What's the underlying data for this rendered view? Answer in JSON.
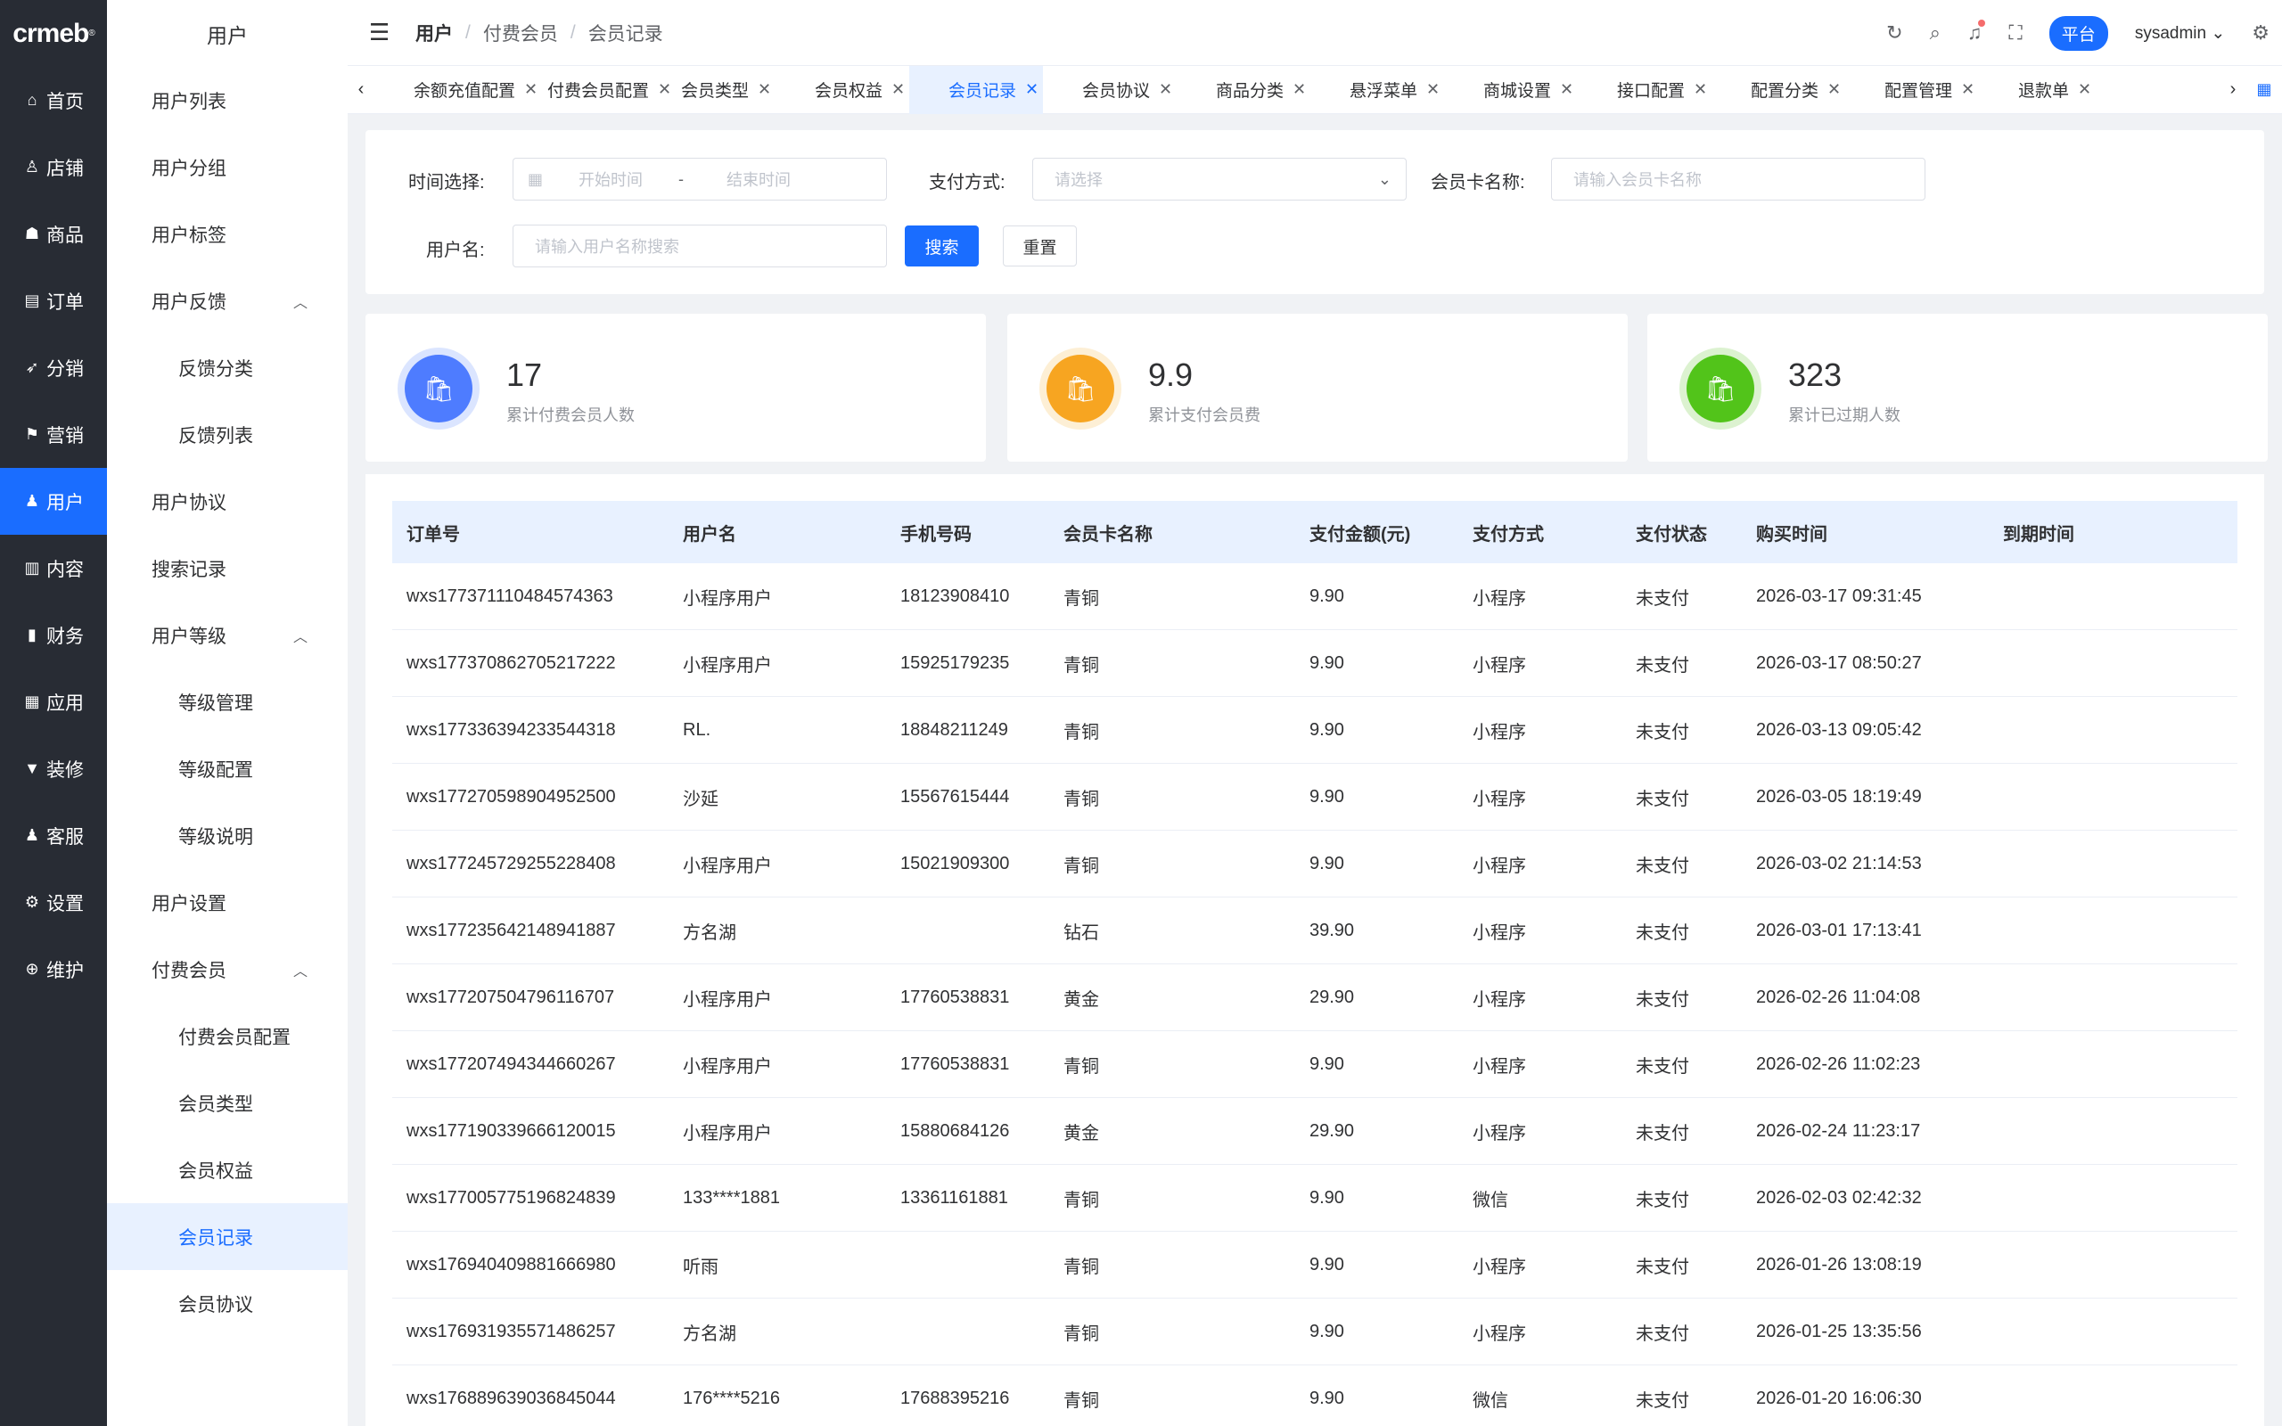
{
  "brand": {
    "logo_text": "crmeb",
    "logo_mark": "®"
  },
  "rail": [
    {
      "label": "首页",
      "icon": "home-icon",
      "glyph": "⌂"
    },
    {
      "label": "店铺",
      "icon": "store-icon",
      "glyph": "♙"
    },
    {
      "label": "商品",
      "icon": "goods-icon",
      "glyph": "☗"
    },
    {
      "label": "订单",
      "icon": "order-icon",
      "glyph": "▤"
    },
    {
      "label": "分销",
      "icon": "distribution-icon",
      "glyph": "➶"
    },
    {
      "label": "营销",
      "icon": "marketing-icon",
      "glyph": "⚑"
    },
    {
      "label": "用户",
      "icon": "user-icon",
      "glyph": "♟",
      "active": true
    },
    {
      "label": "内容",
      "icon": "content-icon",
      "glyph": "▥"
    },
    {
      "label": "财务",
      "icon": "finance-icon",
      "glyph": "▮"
    },
    {
      "label": "应用",
      "icon": "apps-icon",
      "glyph": "▦"
    },
    {
      "label": "装修",
      "icon": "decorate-icon",
      "glyph": "▼"
    },
    {
      "label": "客服",
      "icon": "service-icon",
      "glyph": "♟"
    },
    {
      "label": "设置",
      "icon": "settings-icon",
      "glyph": "⚙"
    },
    {
      "label": "维护",
      "icon": "maintain-icon",
      "glyph": "⊕"
    }
  ],
  "submenu": {
    "title": "用户",
    "items": [
      {
        "label": "用户列表",
        "level": 1
      },
      {
        "label": "用户分组",
        "level": 1
      },
      {
        "label": "用户标签",
        "level": 1
      },
      {
        "label": "用户反馈",
        "level": 1,
        "expanded": true
      },
      {
        "label": "反馈分类",
        "level": 2
      },
      {
        "label": "反馈列表",
        "level": 2
      },
      {
        "label": "用户协议",
        "level": 1
      },
      {
        "label": "搜索记录",
        "level": 1
      },
      {
        "label": "用户等级",
        "level": 1,
        "expanded": true
      },
      {
        "label": "等级管理",
        "level": 2
      },
      {
        "label": "等级配置",
        "level": 2
      },
      {
        "label": "等级说明",
        "level": 2
      },
      {
        "label": "用户设置",
        "level": 1
      },
      {
        "label": "付费会员",
        "level": 1,
        "expanded": true
      },
      {
        "label": "付费会员配置",
        "level": 2
      },
      {
        "label": "会员类型",
        "level": 2
      },
      {
        "label": "会员权益",
        "level": 2
      },
      {
        "label": "会员记录",
        "level": 2,
        "active": true
      },
      {
        "label": "会员协议",
        "level": 2
      }
    ]
  },
  "header": {
    "breadcrumb": [
      "用户",
      "付费会员",
      "会员记录"
    ],
    "platform_label": "平台",
    "username": "sysadmin"
  },
  "tabs": [
    {
      "label": "余额充值配置"
    },
    {
      "label": "付费会员配置"
    },
    {
      "label": "会员类型"
    },
    {
      "label": "会员权益"
    },
    {
      "label": "会员记录",
      "active": true
    },
    {
      "label": "会员协议"
    },
    {
      "label": "商品分类"
    },
    {
      "label": "悬浮菜单"
    },
    {
      "label": "商城设置"
    },
    {
      "label": "接口配置"
    },
    {
      "label": "配置分类"
    },
    {
      "label": "配置管理"
    },
    {
      "label": "退款单"
    }
  ],
  "filter": {
    "time_label": "时间选择:",
    "start_placeholder": "开始时间",
    "range_sep": "-",
    "end_placeholder": "结束时间",
    "pay_label": "支付方式:",
    "pay_placeholder": "请选择",
    "card_label": "会员卡名称:",
    "card_placeholder": "请输入会员卡名称",
    "user_label": "用户名:",
    "user_placeholder": "请输入用户名称搜索",
    "search_btn": "搜索",
    "reset_btn": "重置"
  },
  "stats": [
    {
      "value": "17",
      "label": "累计付费会员人数",
      "color": "#4e7cff",
      "ring": "#dbe5ff"
    },
    {
      "value": "9.9",
      "label": "累计支付会员费",
      "color": "#f7a521",
      "ring": "#fdefd5"
    },
    {
      "value": "323",
      "label": "累计已过期人数",
      "color": "#52c41a",
      "ring": "#dcf2d0"
    }
  ],
  "table": {
    "headers": [
      "订单号",
      "用户名",
      "手机号码",
      "会员卡名称",
      "支付金额(元)",
      "支付方式",
      "支付状态",
      "购买时间",
      "到期时间"
    ],
    "rows": [
      [
        "wxs177371110484574363",
        "小程序用户",
        "18123908410",
        "青铜",
        "9.90",
        "小程序",
        "未支付",
        "2026-03-17 09:31:45",
        ""
      ],
      [
        "wxs177370862705217222",
        "小程序用户",
        "15925179235",
        "青铜",
        "9.90",
        "小程序",
        "未支付",
        "2026-03-17 08:50:27",
        ""
      ],
      [
        "wxs177336394233544318",
        "RL.",
        "18848211249",
        "青铜",
        "9.90",
        "小程序",
        "未支付",
        "2026-03-13 09:05:42",
        ""
      ],
      [
        "wxs177270598904952500",
        "沙延",
        "15567615444",
        "青铜",
        "9.90",
        "小程序",
        "未支付",
        "2026-03-05 18:19:49",
        ""
      ],
      [
        "wxs177245729255228408",
        "小程序用户",
        "15021909300",
        "青铜",
        "9.90",
        "小程序",
        "未支付",
        "2026-03-02 21:14:53",
        ""
      ],
      [
        "wxs177235642148941887",
        "方名湖",
        "",
        "钻石",
        "39.90",
        "小程序",
        "未支付",
        "2026-03-01 17:13:41",
        ""
      ],
      [
        "wxs177207504796116707",
        "小程序用户",
        "17760538831",
        "黄金",
        "29.90",
        "小程序",
        "未支付",
        "2026-02-26 11:04:08",
        ""
      ],
      [
        "wxs177207494344660267",
        "小程序用户",
        "17760538831",
        "青铜",
        "9.90",
        "小程序",
        "未支付",
        "2026-02-26 11:02:23",
        ""
      ],
      [
        "wxs177190339666120015",
        "小程序用户",
        "15880684126",
        "黄金",
        "29.90",
        "小程序",
        "未支付",
        "2026-02-24 11:23:17",
        ""
      ],
      [
        "wxs177005775196824839",
        "133****1881",
        "13361161881",
        "青铜",
        "9.90",
        "微信",
        "未支付",
        "2026-02-03 02:42:32",
        ""
      ],
      [
        "wxs176940409881666980",
        "听雨",
        "",
        "青铜",
        "9.90",
        "小程序",
        "未支付",
        "2026-01-26 13:08:19",
        ""
      ],
      [
        "wxs176931935571486257",
        "方名湖",
        "",
        "青铜",
        "9.90",
        "小程序",
        "未支付",
        "2026-01-25 13:35:56",
        ""
      ],
      [
        "wxs176889639036845044",
        "176****5216",
        "17688395216",
        "青铜",
        "9.90",
        "微信",
        "未支付",
        "2026-01-20 16:06:30",
        ""
      ]
    ]
  }
}
